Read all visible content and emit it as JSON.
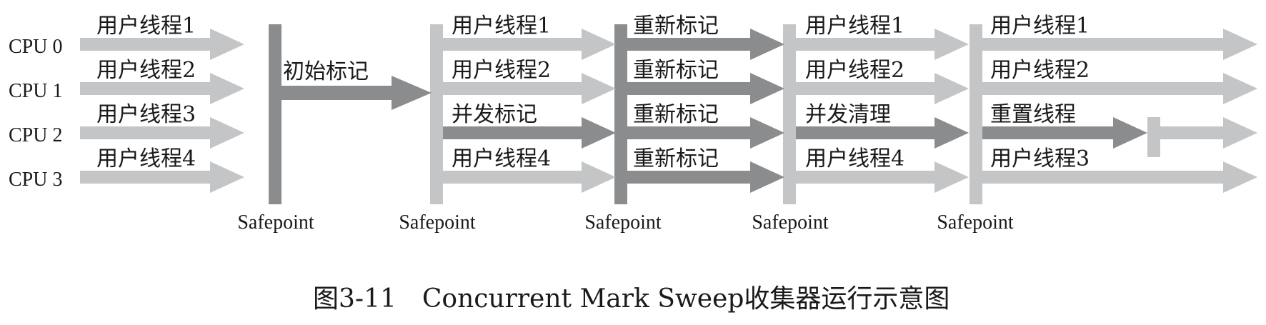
{
  "cpus": [
    "CPU 0",
    "CPU 1",
    "CPU 2",
    "CPU 3"
  ],
  "safepoint_label": "Safepoint",
  "phases": [
    {
      "threads": [
        "用户线程1",
        "用户线程2",
        "用户线程3",
        "用户线程4"
      ]
    },
    {
      "threads": [
        "初始标记"
      ]
    },
    {
      "threads": [
        "用户线程1",
        "用户线程2",
        "并发标记",
        "用户线程4"
      ]
    },
    {
      "threads": [
        "重新标记",
        "重新标记",
        "重新标记",
        "重新标记"
      ]
    },
    {
      "threads": [
        "用户线程1",
        "用户线程2",
        "并发清理",
        "用户线程4"
      ]
    },
    {
      "threads": [
        "用户线程1",
        "用户线程2",
        "重置线程",
        "用户线程3"
      ]
    }
  ],
  "caption": "图3-11　Concurrent Mark Sweep收集器运行示意图",
  "colors": {
    "user_thread": "#c4c5c7",
    "gc_thread": "#8a8c8e",
    "safepoint_bar_dark": "#8a8c8e",
    "safepoint_bar_light": "#c4c5c7"
  }
}
